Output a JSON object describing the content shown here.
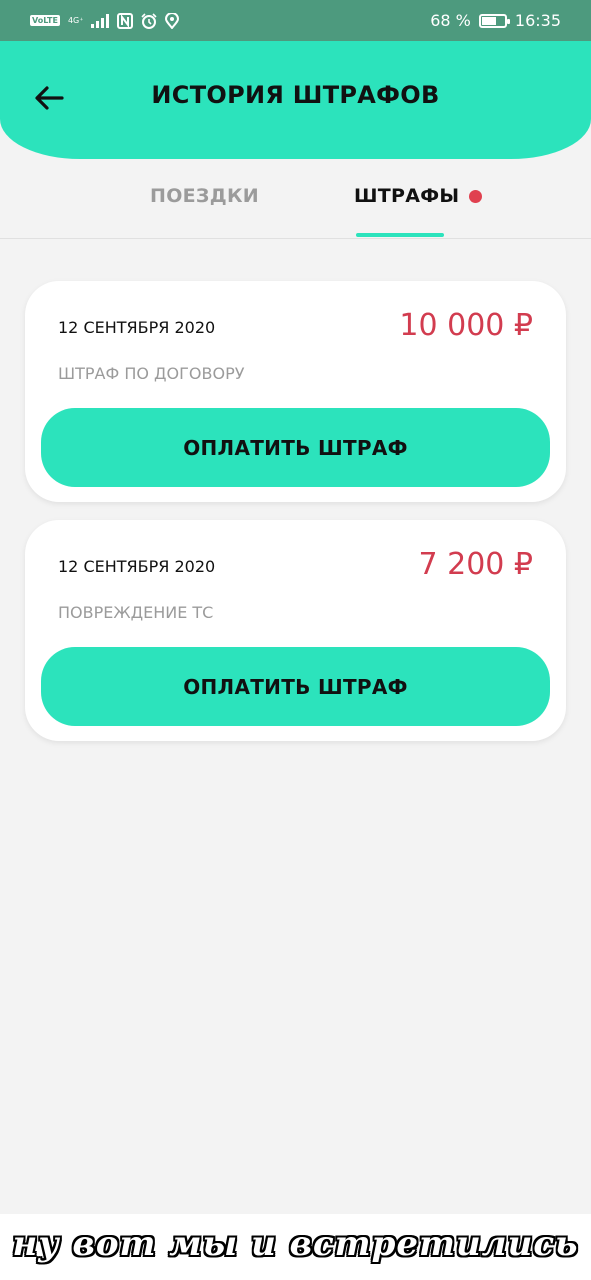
{
  "status_bar": {
    "volte": "VoLTE",
    "network": "4G⁺",
    "battery_percent": "68 %",
    "battery_level": 0.68,
    "time": "16:35",
    "icons": [
      "volte-icon",
      "signal-icon",
      "nfc-icon",
      "alarm-icon",
      "location-icon",
      "battery-icon"
    ]
  },
  "header": {
    "title": "ИСТОРИЯ ШТРАФОВ",
    "back_icon": "arrow-left-icon",
    "color": "#2ce3bc"
  },
  "tabs": [
    {
      "label": "ПОЕЗДКИ",
      "active": false
    },
    {
      "label": "ШТРАФЫ",
      "active": true,
      "has_notification_dot": true
    }
  ],
  "fines": [
    {
      "date": "12 СЕНТЯБРЯ 2020",
      "amount": "10 000 ₽",
      "reason": "ШТРАФ ПО ДОГОВОРУ",
      "button_label": "ОПЛАТИТЬ ШТРАФ"
    },
    {
      "date": "12 СЕНТЯБРЯ 2020",
      "amount": "7 200 ₽",
      "reason": "ПОВРЕЖДЕНИЕ ТС",
      "button_label": "ОПЛАТИТЬ ШТРАФ"
    }
  ],
  "caption": "ну вот мы и встретились",
  "colors": {
    "accent": "#2ce3bc",
    "amount": "#d23c4f",
    "status_bar": "#4d9a7e",
    "background": "#f3f3f3"
  }
}
